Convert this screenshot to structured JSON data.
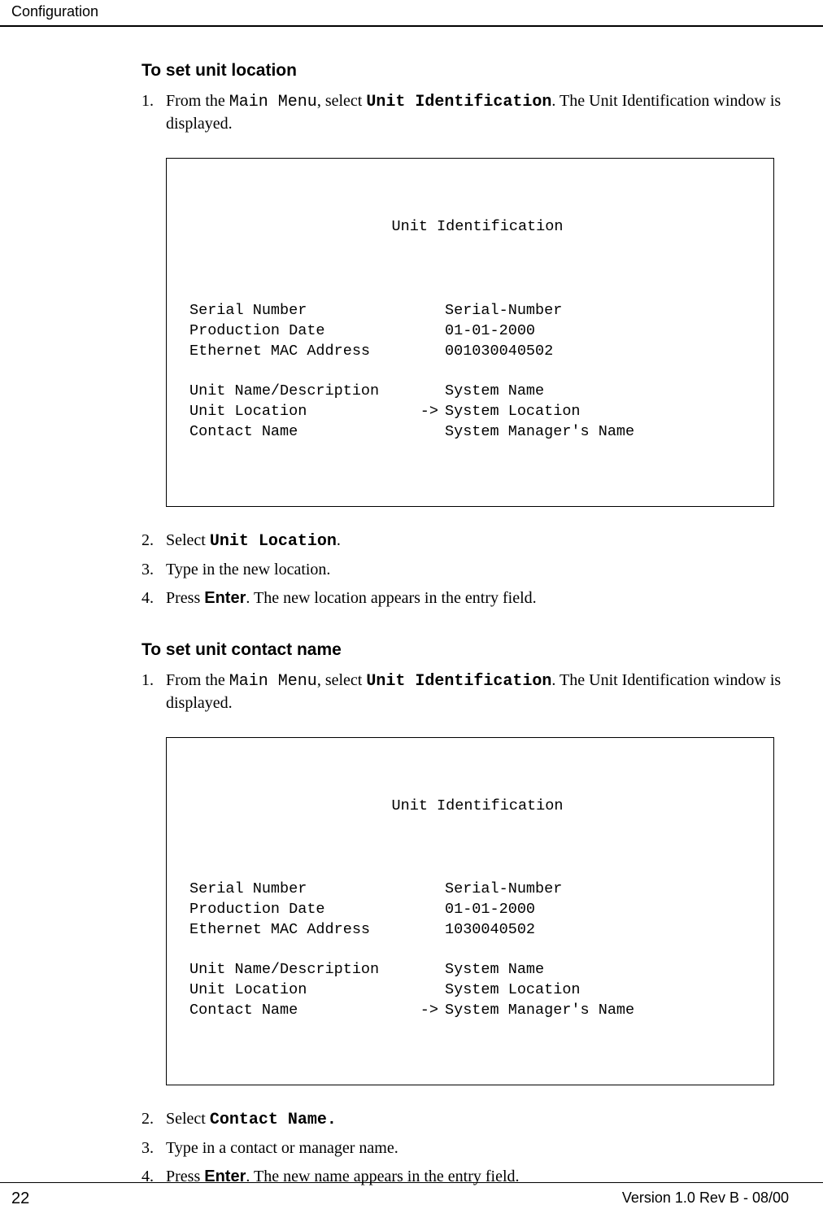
{
  "header": "Configuration",
  "footer": {
    "page": "22",
    "version": "Version 1.0 Rev B - 08/00"
  },
  "sectionA": {
    "heading": "To set unit location",
    "steps": {
      "s1": {
        "pre": "From the ",
        "m1": "Main Menu",
        "mid": ", select ",
        "m2": "Unit Identification",
        "post": ". The Unit Identification window is displayed."
      },
      "s2": {
        "pre": "Select ",
        "m1": "Unit Location",
        "post": "."
      },
      "s3": {
        "text": "Type in the new location."
      },
      "s4": {
        "pre": "Press ",
        "m1": "Enter",
        "post": ". The new location appears in the entry field."
      }
    },
    "window": {
      "title": "Unit Identification",
      "rows": [
        {
          "label": "Serial Number",
          "sel": "",
          "value": "Serial-Number"
        },
        {
          "label": "Production Date",
          "sel": "",
          "value": "01-01-2000"
        },
        {
          "label": "Ethernet MAC Address",
          "sel": "",
          "value": "001030040502"
        },
        {
          "gap": true
        },
        {
          "label": "Unit Name/Description",
          "sel": "",
          "value": "System Name"
        },
        {
          "label": "Unit Location",
          "sel": "->",
          "value": "System Location"
        },
        {
          "label": "Contact Name",
          "sel": "",
          "value": "System Manager's Name"
        }
      ]
    }
  },
  "sectionB": {
    "heading": "To set unit contact name",
    "steps": {
      "s1": {
        "pre": "From the ",
        "m1": "Main Menu",
        "mid": ", select ",
        "m2": "Unit Identification",
        "post": ". The Unit Identification window is displayed."
      },
      "s2": {
        "pre": "Select ",
        "m1": "Contact Name.",
        "post": ""
      },
      "s3": {
        "text": "Type in a contact or manager name."
      },
      "s4": {
        "pre": "Press ",
        "m1": "Enter",
        "post": ". The new name appears in the entry field."
      }
    },
    "window": {
      "title": "Unit Identification",
      "rows": [
        {
          "label": "Serial Number",
          "sel": "",
          "value": "Serial-Number"
        },
        {
          "label": "Production Date",
          "sel": "",
          "value": "01-01-2000"
        },
        {
          "label": "Ethernet MAC Address",
          "sel": "",
          "value": "1030040502"
        },
        {
          "gap": true
        },
        {
          "label": "Unit Name/Description",
          "sel": "",
          "value": "System Name"
        },
        {
          "label": "Unit Location",
          "sel": "",
          "value": "System Location"
        },
        {
          "label": "Contact Name",
          "sel": "->",
          "value": "System Manager's Name"
        }
      ]
    }
  }
}
